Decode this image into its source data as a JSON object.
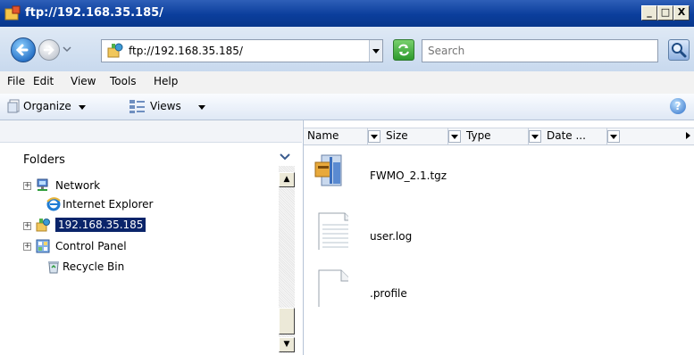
{
  "window": {
    "title": "ftp://192.168.35.185/",
    "controls": {
      "minimize": "_",
      "maximize": "□",
      "close": "X"
    }
  },
  "address_bar": {
    "value": "ftp://192.168.35.185/"
  },
  "search": {
    "placeholder": "Search"
  },
  "menu": [
    "File",
    "Edit",
    "View",
    "Tools",
    "Help"
  ],
  "command_bar": {
    "organize": "Organize",
    "views": "Views"
  },
  "folders": {
    "label": "Folders",
    "items": [
      {
        "label": "Network",
        "icon": "network-icon",
        "expandable": true
      },
      {
        "label": "Internet Explorer",
        "icon": "internet-explorer-icon",
        "expandable": false
      },
      {
        "label": "192.168.35.185",
        "icon": "ftp-server-icon",
        "expandable": true,
        "selected": true
      },
      {
        "label": "Control Panel",
        "icon": "control-panel-icon",
        "expandable": true
      },
      {
        "label": "Recycle Bin",
        "icon": "recycle-bin-icon",
        "expandable": false
      }
    ]
  },
  "columns": [
    "Name",
    "Size",
    "Type",
    "Date ..."
  ],
  "files": [
    {
      "name": "FWMO_2.1.tgz",
      "icon": "archive-icon"
    },
    {
      "name": "user.log",
      "icon": "text-file-icon"
    },
    {
      "name": ".profile",
      "icon": "blank-file-icon"
    }
  ],
  "colors": {
    "titlebar": "#0b3e9c",
    "selection": "#0a246a"
  }
}
